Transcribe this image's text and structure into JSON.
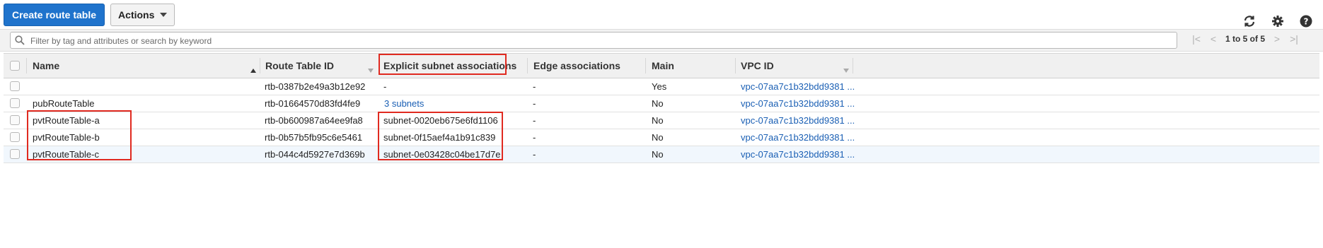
{
  "toolbar": {
    "create_label": "Create route table",
    "actions_label": "Actions"
  },
  "top_icons": [
    "refresh-icon",
    "gear-icon",
    "help-icon"
  ],
  "search": {
    "placeholder": "Filter by tag and attributes or search by keyword",
    "value": ""
  },
  "pagination": {
    "label": "1 to 5 of 5"
  },
  "table": {
    "columns": [
      "Name",
      "Route Table ID",
      "Explicit subnet associations",
      "Edge associations",
      "Main",
      "VPC ID"
    ],
    "rows": [
      {
        "name": "",
        "id": "rtb-0387b2e49a3b12e92",
        "subnet": "-",
        "edge": "-",
        "main": "Yes",
        "vpc": "vpc-07aa7c1b32bdd9381 ..."
      },
      {
        "name": "pubRouteTable",
        "id": "rtb-01664570d83fd4fe9",
        "subnet": "3 subnets",
        "edge": "-",
        "main": "No",
        "vpc": "vpc-07aa7c1b32bdd9381 ..."
      },
      {
        "name": "pvtRouteTable-a",
        "id": "rtb-0b600987a64ee9fa8",
        "subnet": "subnet-0020eb675e6fd1106",
        "edge": "-",
        "main": "No",
        "vpc": "vpc-07aa7c1b32bdd9381 ..."
      },
      {
        "name": "pvtRouteTable-b",
        "id": "rtb-0b57b5fb95c6e5461",
        "subnet": "subnet-0f15aef4a1b91c839",
        "edge": "-",
        "main": "No",
        "vpc": "vpc-07aa7c1b32bdd9381 ..."
      },
      {
        "name": "pvtRouteTable-c",
        "id": "rtb-044c4d5927e7d369b",
        "subnet": "subnet-0e03428c04be17d7e",
        "edge": "-",
        "main": "No",
        "vpc": "vpc-07aa7c1b32bdd9381 ..."
      }
    ]
  },
  "colors": {
    "primary": "#1f73cc",
    "link": "#1a5fb4",
    "highlight": "#e02a20"
  }
}
